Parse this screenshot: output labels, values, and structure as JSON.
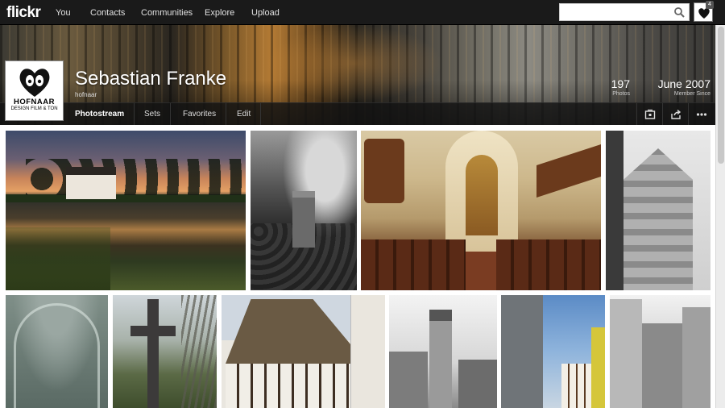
{
  "nav": {
    "logo": "flickr",
    "links": [
      "You",
      "Contacts",
      "Communities",
      "Explore",
      "Upload"
    ],
    "search_value": "",
    "notification_count": "4"
  },
  "profile": {
    "logo_name": "HOFNAAR",
    "logo_sub": "DESIGN FILM & TON",
    "name": "Sebastian Franke",
    "username": "hofnaar",
    "photos_count": "197",
    "photos_label": "Photos",
    "member_since": "June 2007",
    "member_since_label": "Member Since"
  },
  "tabs": [
    "Photostream",
    "Sets",
    "Favorites",
    "Edit"
  ],
  "photos": [
    "lake-sunset",
    "cemetery",
    "church-interior",
    "gabled-townhall",
    "gothic-vault",
    "iron-cross",
    "half-timbered-house",
    "clock-tower",
    "old-street",
    "street-view"
  ]
}
